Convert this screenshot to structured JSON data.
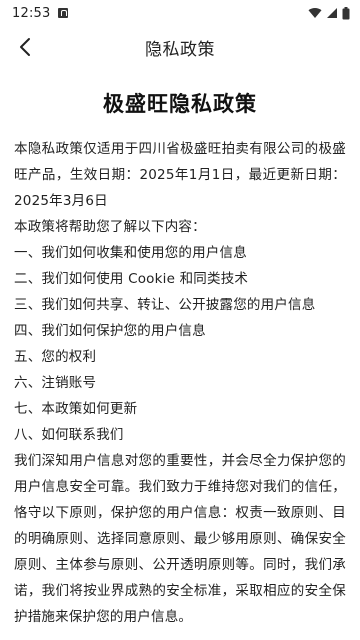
{
  "status_bar": {
    "time": "12:53",
    "icons": [
      "notification-icon",
      "wifi-icon",
      "signal-icon",
      "battery-icon"
    ]
  },
  "app_bar": {
    "title": "隐私政策",
    "back_icon": "chevron-left-icon"
  },
  "document": {
    "title": "极盛旺隐私政策",
    "intro": "本隐私政策仅适用于四川省极盛旺拍卖有限公司的极盛旺产品，生效日期：2025年1月1日，最近更新日期：2025年3月6日",
    "lead": "本政策将帮助您了解以下内容：",
    "toc": [
      "一、我们如何收集和使用您的用户信息",
      "二、我们如何使用 Cookie 和同类技术",
      "三、我们如何共享、转让、公开披露您的用户信息",
      "四、我们如何保护您的用户信息",
      "五、您的权利",
      "六、注销账号",
      "七、本政策如何更新",
      "八、如何联系我们"
    ],
    "body": "我们深知用户信息对您的重要性，并会尽全力保护您的用户信息安全可靠。我们致力于维持您对我们的信任，恪守以下原则，保护您的用户信息：权责一致原则、目的明确原则、选择同意原则、最少够用原则、确保安全原则、主体参与原则、公开透明原则等。同时，我们承诺，我们将按业界成熟的安全标准，采取相应的安全保护措施来保护您的用户信息。"
  }
}
